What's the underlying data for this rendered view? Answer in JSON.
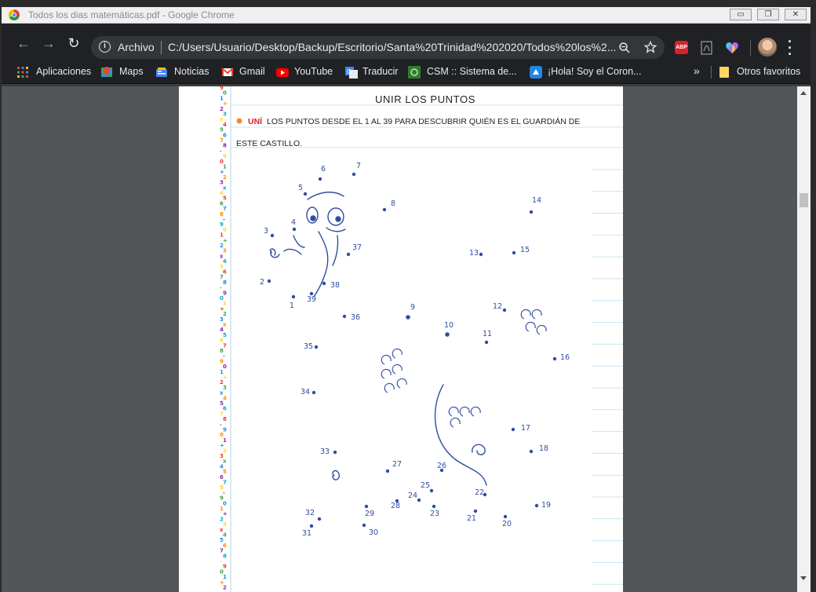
{
  "window": {
    "title": "Todos los dias matemáticas.pdf - Google Chrome",
    "minimize_label": "▭",
    "restore_label": "❐",
    "close_label": "✕"
  },
  "toolbar": {
    "back_icon": "←",
    "forward_icon": "→",
    "reload_icon": "↻",
    "url_scheme": "Archivo",
    "url": "C:/Users/Usuario/Desktop/Backup/Escritorio/Santa%20Trinidad%202020/Todos%20los%2...",
    "zoom_icon": "zoom-icon",
    "star_icon": "star-icon",
    "extensions": [
      "ABP",
      "pdf",
      "heart"
    ]
  },
  "bookmarks": {
    "items": [
      {
        "label": "Aplicaciones",
        "icon": "apps-icon"
      },
      {
        "label": "Maps",
        "icon": "maps-icon"
      },
      {
        "label": "Noticias",
        "icon": "news-icon"
      },
      {
        "label": "Gmail",
        "icon": "gmail-icon"
      },
      {
        "label": "YouTube",
        "icon": "youtube-icon"
      },
      {
        "label": "Traducir",
        "icon": "translate-icon"
      },
      {
        "label": "CSM :: Sistema de...",
        "icon": "csm-icon"
      },
      {
        "label": "¡Hola! Soy el Coron...",
        "icon": "hola-icon"
      }
    ],
    "overflow": "»",
    "other_label": "Otros favoritos"
  },
  "document": {
    "title": "UNIR LOS PUNTOS",
    "instruction_verb": "UNÍ",
    "instruction_line1": "LOS PUNTOS DESDE EL 1 AL 39 PARA DESCUBRIR QUIÉN ES EL GUARDIÁN DE",
    "instruction_line2": "ESTE CASTILLO.",
    "dots": [
      "1",
      "2",
      "3",
      "4",
      "5",
      "6",
      "7",
      "8",
      "9",
      "10",
      "11",
      "12",
      "13",
      "14",
      "15",
      "16",
      "17",
      "18",
      "19",
      "20",
      "21",
      "22",
      "23",
      "24",
      "25",
      "26",
      "27",
      "28",
      "29",
      "30",
      "31",
      "32",
      "33",
      "34",
      "35",
      "36",
      "37",
      "38",
      "39"
    ]
  },
  "colors": {
    "ink": "#2f4ea0",
    "accent_red": "#d8232a",
    "bullet_orange": "#f28c28",
    "rule_blue": "#c9e3ef"
  }
}
